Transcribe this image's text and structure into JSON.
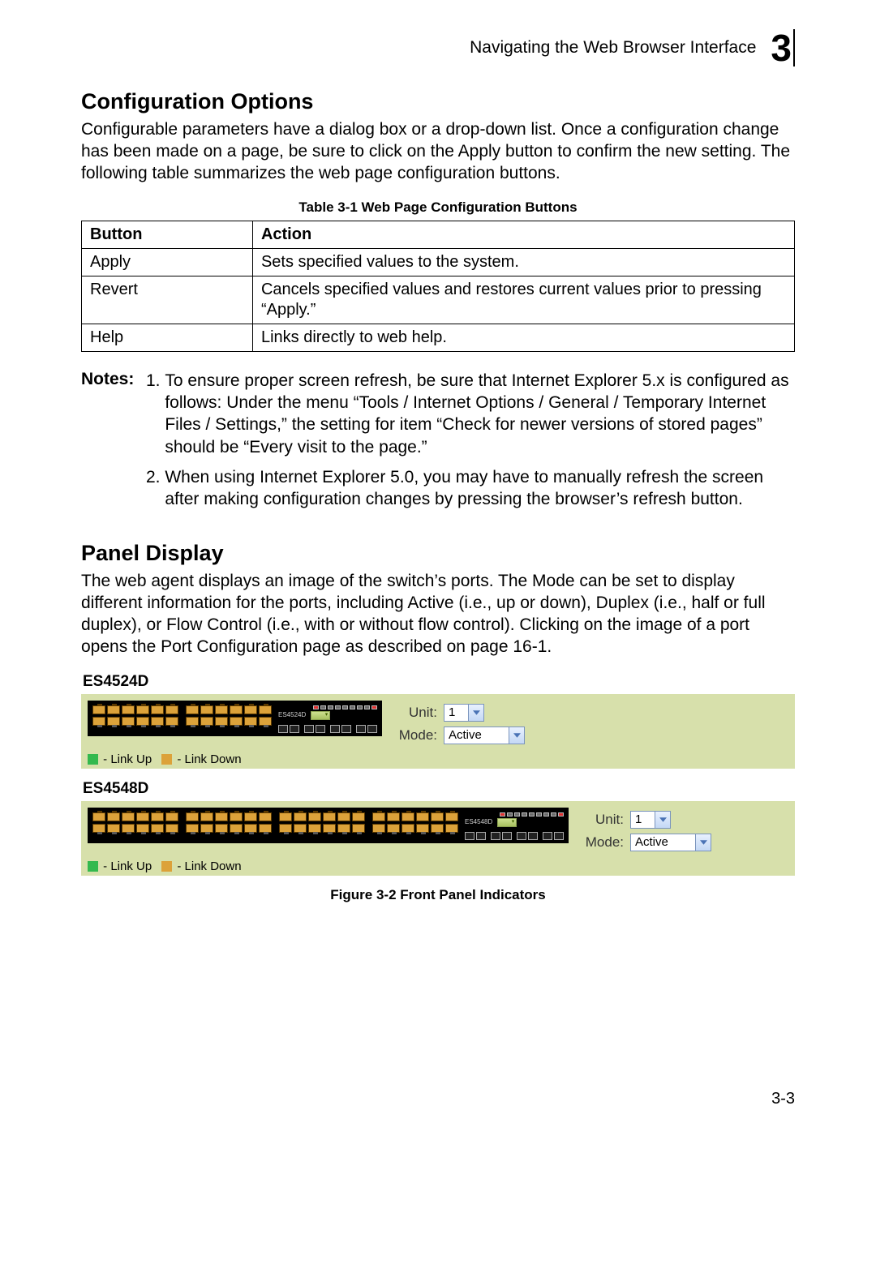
{
  "running_head": {
    "title": "Navigating the Web Browser Interface",
    "chapter_number": "3"
  },
  "section1": {
    "heading": "Configuration Options",
    "paragraph": "Configurable parameters have a dialog box or a drop-down list. Once a configuration change has been made on a page, be sure to click on the Apply button to confirm the new setting. The following table summarizes the web page configuration buttons."
  },
  "table": {
    "caption": "Table 3-1  Web Page Configuration Buttons",
    "head": {
      "c1": "Button",
      "c2": "Action"
    },
    "rows": [
      {
        "c1": "Apply",
        "c2": "Sets specified values to the system."
      },
      {
        "c1": "Revert",
        "c2": "Cancels specified values and restores current values prior to pressing “Apply.”"
      },
      {
        "c1": "Help",
        "c2": "Links directly to web help."
      }
    ]
  },
  "notes": {
    "label": "Notes:",
    "items": [
      "To ensure proper screen refresh, be sure that Internet Explorer 5.x is configured as follows: Under the menu “Tools / Internet Options / General / Temporary Internet Files / Settings,” the setting for item “Check for newer versions of stored pages” should be “Every visit to the page.”",
      "When using Internet Explorer 5.0, you may have to manually refresh the screen after making configuration changes by pressing the browser’s refresh button."
    ]
  },
  "section2": {
    "heading": "Panel Display",
    "paragraph": "The web agent displays an image of the switch’s ports. The Mode can be set to display different information for the ports, including Active (i.e., up or down), Duplex (i.e., half or full duplex), or Flow Control (i.e., with or without flow control). Clicking on the image of a port opens the Port Configuration page as described on page 16-1."
  },
  "panels": {
    "p24": {
      "label": "ES4524D",
      "model_id": "ES4524D",
      "unit_label": "Unit:",
      "unit_value": "1",
      "mode_label": "Mode:",
      "mode_value": "Active"
    },
    "p48": {
      "label": "ES4548D",
      "model_id": "ES4548D",
      "unit_label": "Unit:",
      "unit_value": "1",
      "mode_label": "Mode:",
      "mode_value": "Active"
    },
    "legend": {
      "up": "- Link Up",
      "down": "- Link Down"
    }
  },
  "figure_caption": "Figure 3-2  Front Panel Indicators",
  "footer_page": "3-3"
}
